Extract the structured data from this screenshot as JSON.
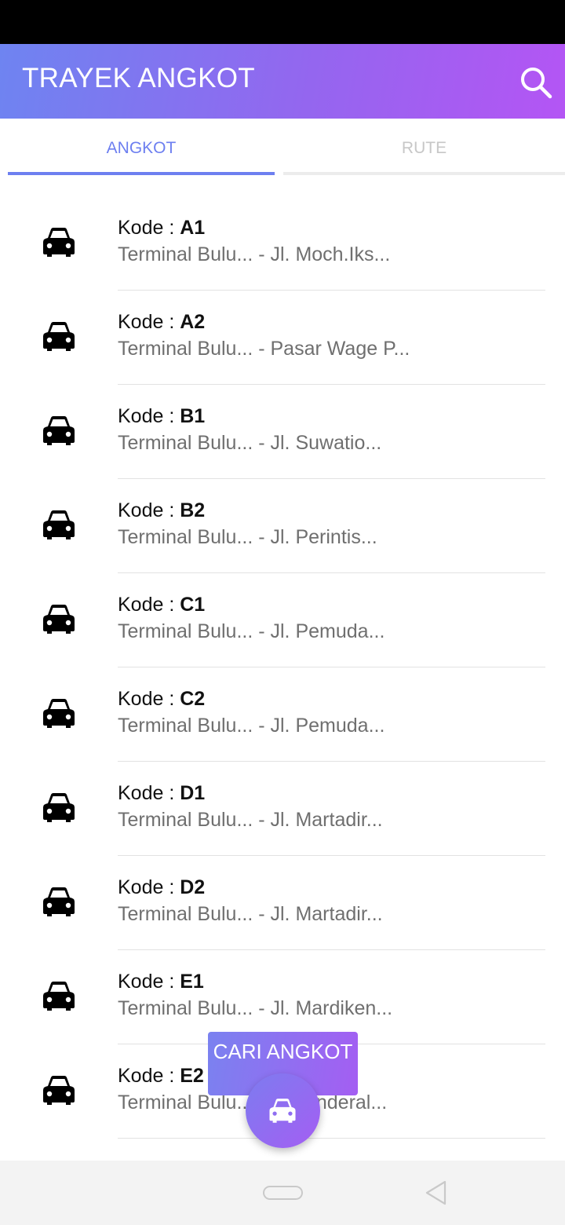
{
  "app_bar": {
    "title": "TRAYEK ANGKOT",
    "search_icon": "search-icon",
    "gradient": [
      "#6e84f1",
      "#b455f4"
    ]
  },
  "tabs": [
    {
      "label": "ANGKOT",
      "selected": true,
      "color": "#6d7ff0"
    },
    {
      "label": "RUTE",
      "selected": false,
      "color": "#c7c7c7"
    }
  ],
  "list": {
    "kode_label": "Kode : ",
    "items": [
      {
        "code": "A1",
        "route": "Terminal Bulu... - Jl. Moch.Iks..."
      },
      {
        "code": "A2",
        "route": "Terminal Bulu... - Pasar Wage P..."
      },
      {
        "code": "B1",
        "route": "Terminal Bulu... - Jl. Suwatio..."
      },
      {
        "code": "B2",
        "route": "Terminal Bulu... - Jl. Perintis..."
      },
      {
        "code": "C1",
        "route": "Terminal Bulu... - Jl. Pemuda..."
      },
      {
        "code": "C2",
        "route": "Terminal Bulu... - Jl. Pemuda..."
      },
      {
        "code": "D1",
        "route": "Terminal Bulu... - Jl. Martadir..."
      },
      {
        "code": "D2",
        "route": "Terminal Bulu... - Jl. Martadir..."
      },
      {
        "code": "E1",
        "route": "Terminal Bulu... - Jl. Mardiken..."
      },
      {
        "code": "E2",
        "route": "Terminal Bulu... - Jl. Jenderal..."
      }
    ]
  },
  "cari_button": {
    "label": "CARI ANGKOT"
  },
  "fab": {
    "icon": "car-icon"
  },
  "nav": {
    "home_icon": "home-pill-icon",
    "back_icon": "back-triangle-icon"
  }
}
